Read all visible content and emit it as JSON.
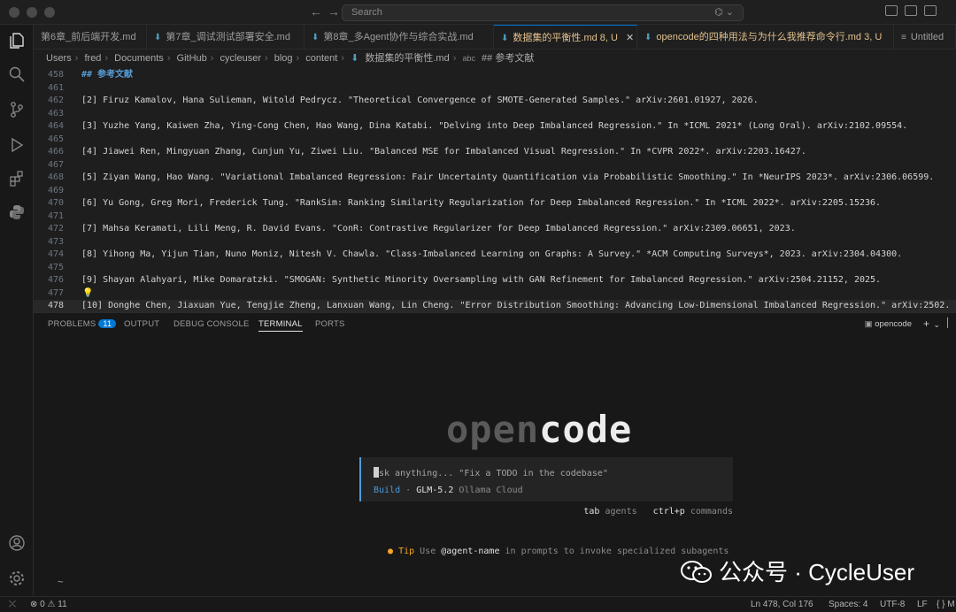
{
  "titlebar": {
    "search_placeholder": "Search",
    "chat_label": "⌬ ⌄"
  },
  "tabs": [
    {
      "label": "第6章_前后端开发.md",
      "status": ""
    },
    {
      "label": "第7章_调试测试部署安全.md",
      "status": ""
    },
    {
      "label": "第8章_多Agent协作与综合实战.md",
      "status": ""
    },
    {
      "label": "数据集的平衡性.md",
      "status": "8, U"
    },
    {
      "label": "opencode的四种用法与为什么我推荐命令行.md",
      "status": "3, U"
    },
    {
      "label": "Untitled",
      "status": ""
    }
  ],
  "breadcrumb": [
    "Users",
    "fred",
    "Documents",
    "GitHub",
    "cycleuser",
    "blog",
    "content",
    "数据集的平衡性.md",
    "## 参考文献"
  ],
  "editor": {
    "lines": [
      {
        "n": "458",
        "text": "## 参考文献",
        "kind": "heading"
      },
      {
        "n": "461",
        "text": "",
        "kind": "text"
      },
      {
        "n": "462",
        "text": "[2] Firuz Kamalov, Hana Sulieman, Witold Pedrycz. \"Theoretical Convergence of SMOTE-Generated Samples.\" arXiv:2601.01927, 2026.",
        "kind": "text"
      },
      {
        "n": "463",
        "text": "",
        "kind": "text"
      },
      {
        "n": "464",
        "text": "[3] Yuzhe Yang, Kaiwen Zha, Ying-Cong Chen, Hao Wang, Dina Katabi. \"Delving into Deep Imbalanced Regression.\" In *ICML 2021* (Long Oral). arXiv:2102.09554.",
        "kind": "text"
      },
      {
        "n": "465",
        "text": "",
        "kind": "text"
      },
      {
        "n": "466",
        "text": "[4] Jiawei Ren, Mingyuan Zhang, Cunjun Yu, Ziwei Liu. \"Balanced MSE for Imbalanced Visual Regression.\" In *CVPR 2022*. arXiv:2203.16427.",
        "kind": "text"
      },
      {
        "n": "467",
        "text": "",
        "kind": "text"
      },
      {
        "n": "468",
        "text": "[5] Ziyan Wang, Hao Wang. \"Variational Imbalanced Regression: Fair Uncertainty Quantification via Probabilistic Smoothing.\" In *NeurIPS 2023*. arXiv:2306.06599.",
        "kind": "text"
      },
      {
        "n": "469",
        "text": "",
        "kind": "text"
      },
      {
        "n": "470",
        "text": "[6] Yu Gong, Greg Mori, Frederick Tung. \"RankSim: Ranking Similarity Regularization for Deep Imbalanced Regression.\" In *ICML 2022*. arXiv:2205.15236.",
        "kind": "text"
      },
      {
        "n": "471",
        "text": "",
        "kind": "text"
      },
      {
        "n": "472",
        "text": "[7] Mahsa Keramati, Lili Meng, R. David Evans. \"ConR: Contrastive Regularizer for Deep Imbalanced Regression.\" arXiv:2309.06651, 2023.",
        "kind": "text"
      },
      {
        "n": "473",
        "text": "",
        "kind": "text"
      },
      {
        "n": "474",
        "text": "[8] Yihong Ma, Yijun Tian, Nuno Moniz, Nitesh V. Chawla. \"Class-Imbalanced Learning on Graphs: A Survey.\" *ACM Computing Surveys*, 2023. arXiv:2304.04300.",
        "kind": "text"
      },
      {
        "n": "475",
        "text": "",
        "kind": "text"
      },
      {
        "n": "476",
        "text": "[9] Shayan Alahyari, Mike Domaratzki. \"SMOGAN: Synthetic Minority Oversampling with GAN Refinement for Imbalanced Regression.\" arXiv:2504.21152, 2025.",
        "kind": "text"
      },
      {
        "n": "477",
        "text": "",
        "kind": "bulb"
      },
      {
        "n": "478",
        "text": "[10] Donghe Chen, Jiaxuan Yue, Tengjie Zheng, Lanxuan Wang, Lin Cheng. \"Error Distribution Smoothing: Advancing Low-Dimensional Imbalanced Regression.\" arXiv:2502.",
        "kind": "current"
      }
    ]
  },
  "panel": {
    "tabs": [
      "PROBLEMS",
      "OUTPUT",
      "DEBUG CONSOLE",
      "TERMINAL",
      "PORTS"
    ],
    "problems_count": "11",
    "terminal_name": "opencode"
  },
  "terminal": {
    "logo_dim": "open",
    "logo_lit": "code",
    "prompt_placeholder": "sk anything... \"Fix a TODO in the codebase\"",
    "prompt_first": "A",
    "mode": "Build",
    "dot": "·",
    "model": "GLM-5.2",
    "provider": "Ollama Cloud",
    "hint_key1": "tab",
    "hint_label1": "agents",
    "hint_key2": "ctrl+p",
    "hint_label2": "commands",
    "tip_label": "Tip",
    "tip_pre": "Use",
    "tip_agent": "@agent-name",
    "tip_post": "in prompts to invoke specialized subagents",
    "shell_prompt": "~",
    "watermark": "公众号 · CycleUser"
  },
  "statusbar": {
    "errors": "0",
    "warnings": "11",
    "position": "Ln 478, Col 176",
    "spaces": "Spaces: 4",
    "encoding": "UTF-8",
    "eol": "LF",
    "language": "{ } Markdown"
  }
}
